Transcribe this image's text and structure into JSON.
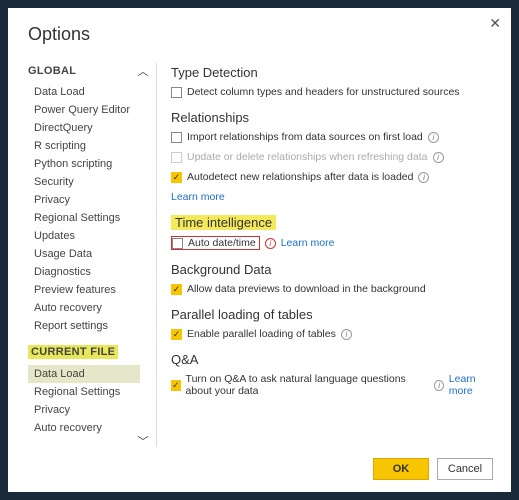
{
  "title": "Options",
  "close": "✕",
  "sidebar": {
    "global_head": "GLOBAL",
    "global_items": [
      "Data Load",
      "Power Query Editor",
      "DirectQuery",
      "R scripting",
      "Python scripting",
      "Security",
      "Privacy",
      "Regional Settings",
      "Updates",
      "Usage Data",
      "Diagnostics",
      "Preview features",
      "Auto recovery",
      "Report settings"
    ],
    "current_head": "CURRENT FILE",
    "current_items": [
      "Data Load",
      "Regional Settings",
      "Privacy",
      "Auto recovery"
    ]
  },
  "sections": {
    "type_detection": {
      "head": "Type Detection",
      "opt1": "Detect column types and headers for unstructured sources"
    },
    "relationships": {
      "head": "Relationships",
      "opt1": "Import relationships from data sources on first load",
      "opt2": "Update or delete relationships when refreshing data",
      "opt3": "Autodetect new relationships after data is loaded",
      "learn": "Learn more"
    },
    "time_intel": {
      "head": "Time intelligence",
      "opt1": "Auto date/time",
      "learn": "Learn more"
    },
    "background": {
      "head": "Background Data",
      "opt1": "Allow data previews to download in the background"
    },
    "parallel": {
      "head": "Parallel loading of tables",
      "opt1": "Enable parallel loading of tables"
    },
    "qna": {
      "head": "Q&A",
      "opt1": "Turn on Q&A to ask natural language questions about your data",
      "learn": "Learn more"
    }
  },
  "footer": {
    "ok": "OK",
    "cancel": "Cancel"
  }
}
